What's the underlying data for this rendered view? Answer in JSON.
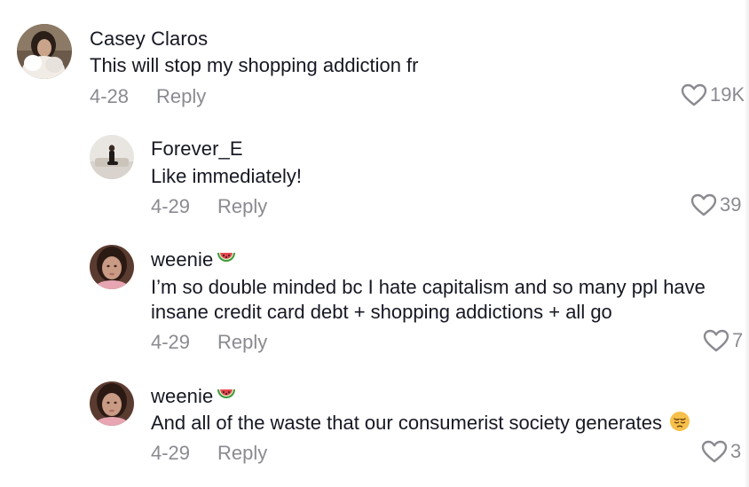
{
  "comments": [
    {
      "username": "Casey Claros",
      "text": "This will stop my shopping addiction fr",
      "date": "4-28",
      "reply_label": "Reply",
      "likes": "19K",
      "avatar": "profile-photo-person"
    },
    {
      "username": "Forever_E",
      "text": "Like immediately!",
      "date": "4-29",
      "reply_label": "Reply",
      "likes": "39",
      "avatar": "profile-photo-person-sitting"
    },
    {
      "username": "weenie",
      "username_emoji": "watermelon-emoji",
      "text_line1": "I’m so double minded bc I hate capitalism and so many ppl have",
      "text_line2": "insane credit card debt + shopping addictions + all go",
      "date": "4-29",
      "reply_label": "Reply",
      "likes": "7",
      "avatar": "profile-photo-selfie"
    },
    {
      "username": "weenie",
      "username_emoji": "watermelon-emoji",
      "text": "And all of the waste that our consumerist society generates",
      "text_emoji": "pensive-face-emoji",
      "date": "4-29",
      "reply_label": "Reply",
      "likes": "3",
      "avatar": "profile-photo-selfie"
    }
  ],
  "colors": {
    "text_primary": "#161823",
    "text_secondary": "#8a8b91",
    "background": "#ffffff"
  }
}
